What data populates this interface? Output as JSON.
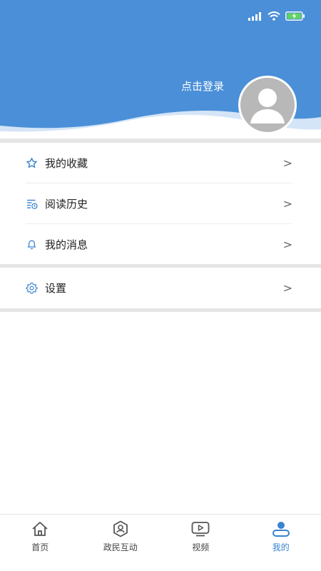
{
  "header": {
    "login_text": "点击登录",
    "background_color": "#4a8fd8"
  },
  "status_bar": {
    "icons": [
      "signal-icon",
      "wifi-icon",
      "battery-charging-icon"
    ]
  },
  "menu_group_1": {
    "items": [
      {
        "label": "我的收藏",
        "icon": "star-icon",
        "arrow": ">"
      },
      {
        "label": "阅读历史",
        "icon": "history-list-icon",
        "arrow": ">"
      },
      {
        "label": "我的消息",
        "icon": "bell-icon",
        "arrow": ">"
      }
    ]
  },
  "menu_group_2": {
    "items": [
      {
        "label": "设置",
        "icon": "gear-icon",
        "arrow": ">"
      }
    ]
  },
  "tabbar": {
    "items": [
      {
        "label": "首页",
        "icon": "home-icon",
        "active": false
      },
      {
        "label": "政民互动",
        "icon": "hexagon-icon",
        "active": false
      },
      {
        "label": "视频",
        "icon": "video-play-icon",
        "active": false
      },
      {
        "label": "我的",
        "icon": "user-icon",
        "active": true
      }
    ],
    "active_color": "#3a83d1"
  }
}
